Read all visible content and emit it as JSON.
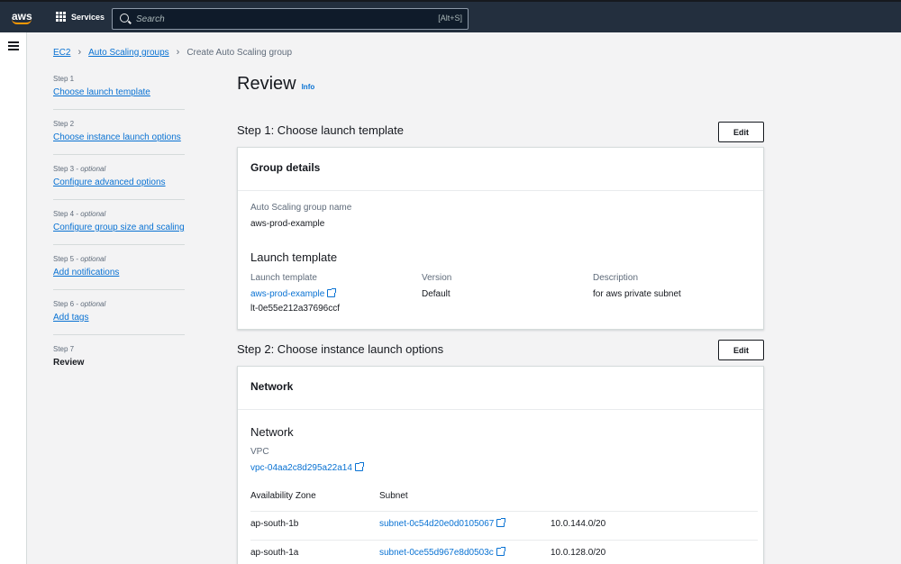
{
  "topnav": {
    "logo_text": "aws",
    "services_label": "Services",
    "search_placeholder": "Search",
    "search_shortcut": "[Alt+S]"
  },
  "breadcrumb": {
    "items": [
      "EC2",
      "Auto Scaling groups"
    ],
    "current": "Create Auto Scaling group"
  },
  "steps": [
    {
      "num": "Step 1",
      "optional": "",
      "label": "Choose launch template"
    },
    {
      "num": "Step 2",
      "optional": "",
      "label": "Choose instance launch options"
    },
    {
      "num": "Step 3",
      "optional": "optional",
      "label": "Configure advanced options"
    },
    {
      "num": "Step 4",
      "optional": "optional",
      "label": "Configure group size and scaling"
    },
    {
      "num": "Step 5",
      "optional": "optional",
      "label": "Add notifications"
    },
    {
      "num": "Step 6",
      "optional": "optional",
      "label": "Add tags"
    },
    {
      "num": "Step 7",
      "optional": "",
      "label": "Review"
    }
  ],
  "optional_sep": " - ",
  "page": {
    "title": "Review",
    "info": "Info"
  },
  "step1": {
    "heading": "Step 1: Choose launch template",
    "edit": "Edit",
    "panel_title": "Group details",
    "asg_name_label": "Auto Scaling group name",
    "asg_name_value": "aws-prod-example",
    "launch_template_heading": "Launch template",
    "lt_label": "Launch template",
    "lt_link": "aws-prod-example",
    "lt_id": "lt-0e55e212a37696ccf",
    "version_label": "Version",
    "version_value": "Default",
    "description_label": "Description",
    "description_value": "for aws private subnet"
  },
  "step2": {
    "heading": "Step 2: Choose instance launch options",
    "edit": "Edit",
    "panel_title": "Network",
    "network_heading": "Network",
    "vpc_label": "VPC",
    "vpc_link": "vpc-04aa2c8d295a22a14",
    "table_headers": [
      "Availability Zone",
      "Subnet"
    ],
    "rows": [
      {
        "az": "ap-south-1b",
        "subnet": "subnet-0c54d20e0d0105067",
        "cidr": "10.0.144.0/20"
      },
      {
        "az": "ap-south-1a",
        "subnet": "subnet-0ce55d967e8d0503c",
        "cidr": "10.0.128.0/20"
      }
    ]
  },
  "colors": {
    "nav_bg": "#232f3e",
    "link": "#0972d3",
    "accent": "#ff9900"
  }
}
